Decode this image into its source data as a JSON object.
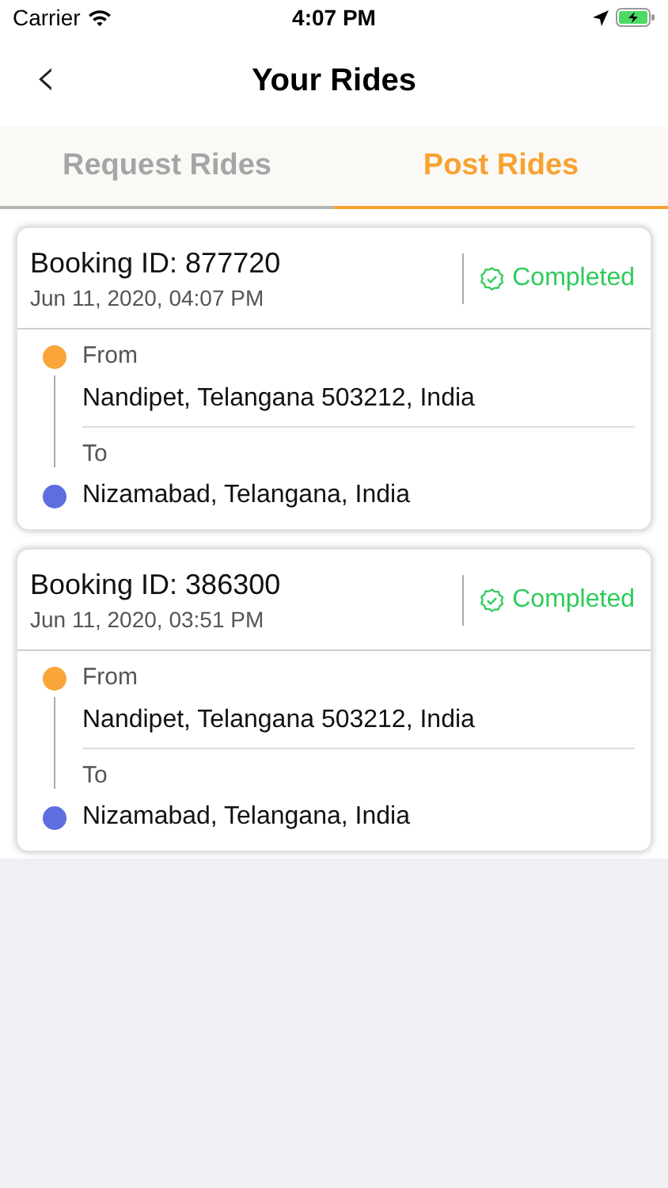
{
  "status_bar": {
    "carrier": "Carrier",
    "time": "4:07 PM"
  },
  "nav": {
    "back": "‹",
    "title": "Your Rides"
  },
  "tabs": [
    {
      "label": "Request Rides",
      "selected": false
    },
    {
      "label": "Post Rides",
      "selected": true
    }
  ],
  "rides": [
    {
      "booking": "Booking ID: 877720",
      "date": "Jun 11, 2020, 04:07 PM",
      "status": {
        "kind": "completed",
        "label": "Completed"
      },
      "from": {
        "label": "From",
        "address": "Nandipet, Telangana 503212, India",
        "color": "#f9a53a"
      },
      "to": {
        "label": "To",
        "address": "Nizamabad, Telangana, India",
        "color": "#5e6ee0"
      }
    },
    {
      "booking": "Booking ID: 386300",
      "date": "Jun 11, 2020, 03:51 PM",
      "status": {
        "kind": "completed",
        "label": "Completed"
      },
      "from": {
        "label": "From",
        "address": "Nandipet, Telangana 503212, India",
        "color": "#f9a53a"
      },
      "to": {
        "label": "To",
        "address": "Nizamabad, Telangana, India",
        "color": "#5e6ee0"
      }
    }
  ]
}
